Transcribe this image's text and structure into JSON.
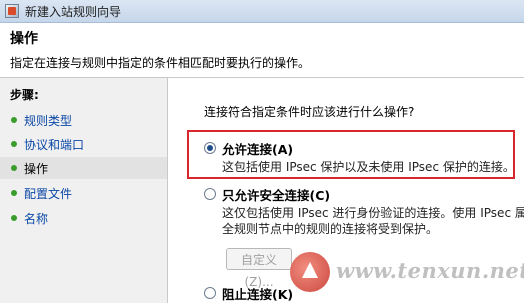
{
  "window": {
    "title": "新建入站规则向导"
  },
  "header": {
    "title": "操作",
    "description": "指定在连接与规则中指定的条件相匹配时要执行的操作。"
  },
  "sidebar": {
    "steps_title": "步骤:",
    "items": [
      {
        "label": "规则类型"
      },
      {
        "label": "协议和端口"
      },
      {
        "label": "操作"
      },
      {
        "label": "配置文件"
      },
      {
        "label": "名称"
      }
    ]
  },
  "main": {
    "question": "连接符合指定条件时应该进行什么操作?",
    "options": [
      {
        "label": "允许连接(A)",
        "description": "这包括使用 IPsec 保护以及未使用 IPsec 保护的连接。",
        "checked": true
      },
      {
        "label": "只允许安全连接(C)",
        "description_line1": "这仅包括使用 IPsec 进行身份验证的连接。使用 IPsec 属",
        "description_line2": "全规则节点中的规则的连接将受到保护。",
        "checked": false
      },
      {
        "label": "阻止连接(K)",
        "checked": false
      }
    ],
    "customize_button": "自定义(Z)..."
  },
  "watermark": {
    "text": "www.tenxun.net"
  },
  "colors": {
    "highlight": "#d9262d",
    "link": "#0a47a6",
    "step_dot": "#3a9c2c"
  }
}
